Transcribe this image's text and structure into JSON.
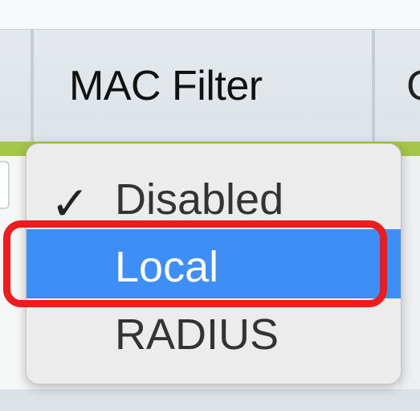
{
  "table": {
    "column_header": "MAC Filter",
    "next_column_header_partial": "C"
  },
  "dropdown": {
    "options": [
      {
        "label": "Disabled",
        "checked": true
      },
      {
        "label": "Local",
        "highlighted": true
      },
      {
        "label": "RADIUS"
      }
    ],
    "check_mark": "✓",
    "highlight_color": "#3e8ef7"
  },
  "annotation": {
    "color": "#ee1c1c"
  }
}
